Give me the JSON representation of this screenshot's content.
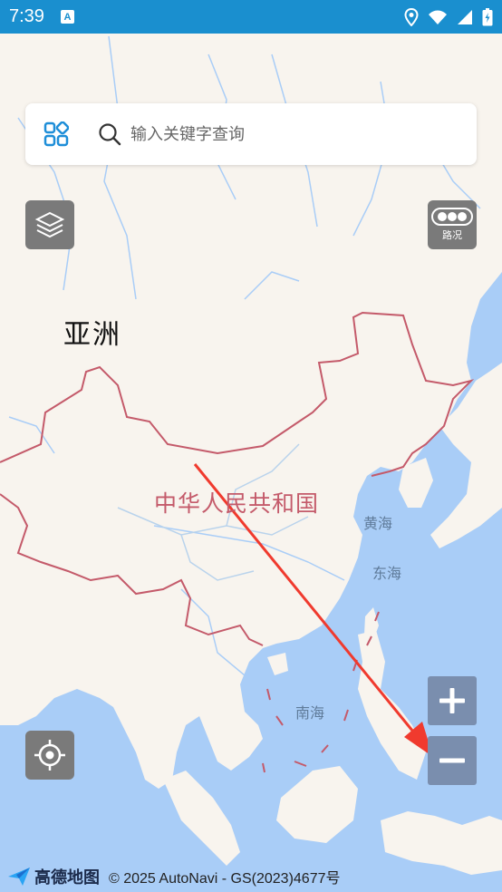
{
  "status_bar": {
    "time": "7:39",
    "notification_icon": "A",
    "icons": [
      "location-icon",
      "wifi-icon",
      "signal-icon",
      "battery-icon"
    ]
  },
  "search": {
    "placeholder": "输入关键字查询"
  },
  "controls": {
    "traffic_label": "路况"
  },
  "map_labels": {
    "continent": "亚洲",
    "country": "中华人民共和国",
    "yellow_sea": "黄海",
    "east_sea": "东海",
    "south_sea": "南海"
  },
  "footer": {
    "brand": "高德地图",
    "copyright": "© 2025 AutoNavi - GS(2023)4677号"
  },
  "colors": {
    "status_bar": "#1a8fcf",
    "sea": "#a9cdf7",
    "land": "#f8f4ee",
    "border": "#c45a6a",
    "annotation_arrow": "#f03a2e"
  }
}
